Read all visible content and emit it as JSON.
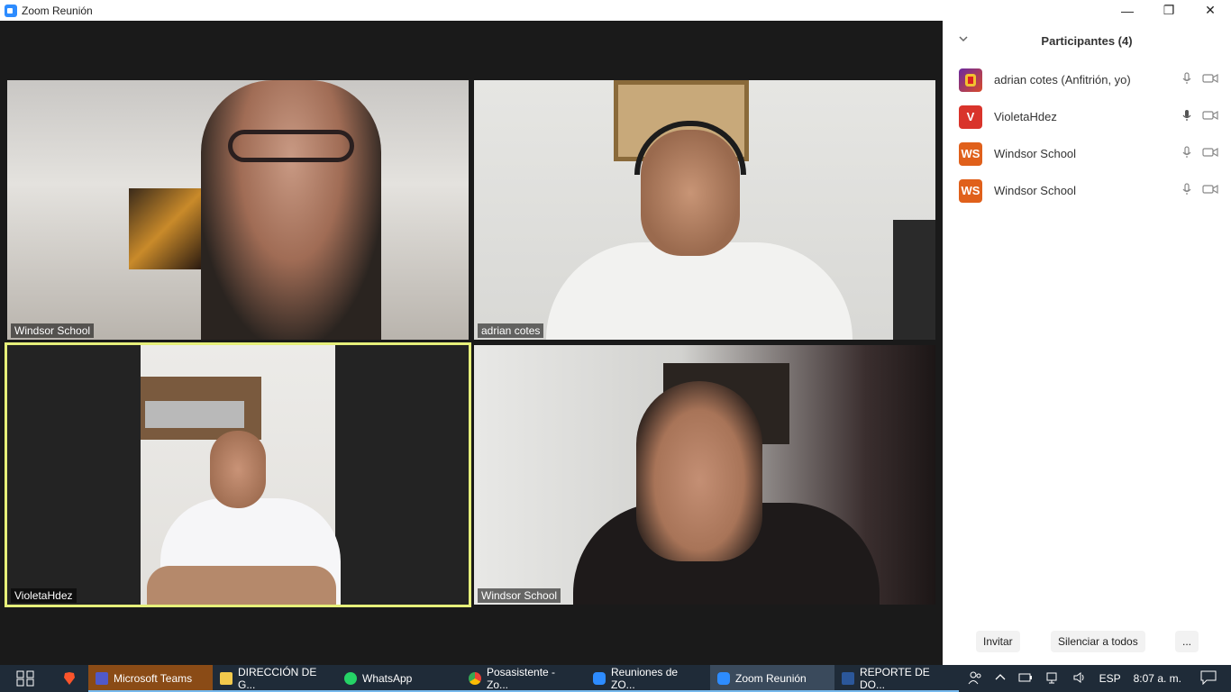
{
  "window": {
    "title": "Zoom Reunión",
    "minimize": "—",
    "restore": "❐",
    "close": "✕"
  },
  "tiles": [
    {
      "name": "Windsor School"
    },
    {
      "name": "adrian cotes"
    },
    {
      "name": "VioletaHdez"
    },
    {
      "name": "Windsor School"
    }
  ],
  "panel": {
    "title": "Participantes (4)",
    "participants": [
      {
        "name": "adrian cotes (Anfitrión, yo)",
        "avatar_text": "",
        "avatar_color": "#6a2aa0"
      },
      {
        "name": "VioletaHdez",
        "avatar_text": "V",
        "avatar_color": "#d9342b"
      },
      {
        "name": "Windsor School",
        "avatar_text": "WS",
        "avatar_color": "#e0601b"
      },
      {
        "name": "Windsor School",
        "avatar_text": "WS",
        "avatar_color": "#e0601b"
      }
    ],
    "invite": "Invitar",
    "mute_all": "Silenciar a todos",
    "more": "..."
  },
  "taskbar": {
    "items": [
      {
        "label": "Microsoft Teams",
        "color": "#5059c9"
      },
      {
        "label": "DIRECCIÓN DE G...",
        "color": "#f2c94c"
      },
      {
        "label": "WhatsApp",
        "color": "#25d366"
      },
      {
        "label": "Posasistente - Zo...",
        "color": "#e94235"
      },
      {
        "label": "Reuniones de ZO...",
        "color": "#2d8cff"
      },
      {
        "label": "Zoom Reunión",
        "color": "#2d8cff"
      },
      {
        "label": "REPORTE DE DO...",
        "color": "#2b579a"
      }
    ],
    "language": "ESP",
    "time": "8:07 a. m."
  }
}
